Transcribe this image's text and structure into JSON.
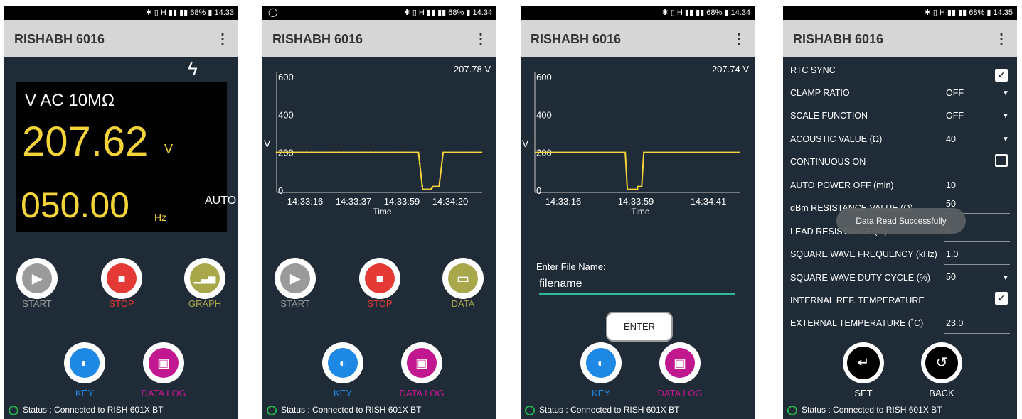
{
  "status_bar": {
    "icons": "✱ ▯ H ▮▮ ▮▮",
    "battery": "68%",
    "times": [
      "14:33",
      "14:34",
      "14:34",
      "14:35"
    ],
    "notif_icon": "whatsapp-icon"
  },
  "app": {
    "title": "RISHABH 6016",
    "menu_icon": "⋮"
  },
  "status_text": "Status : Connected to RISH 601X BT",
  "screen1": {
    "mode": "V AC 10MΩ",
    "value": "207.62",
    "unit": "V",
    "range": "AUTO",
    "freq": "050.00",
    "freq_unit": "Hz",
    "buttons": [
      {
        "label": "START",
        "color": "#9a9a9a"
      },
      {
        "label": "STOP",
        "color": "#e53935"
      },
      {
        "label": "GRAPH",
        "color": "#a8a84a"
      }
    ],
    "buttons2": [
      {
        "label": "KEY",
        "color": "#1e88e5"
      },
      {
        "label": "DATA LOG",
        "color": "#c2188f"
      }
    ]
  },
  "screen2": {
    "readout": "207.78 V",
    "buttons": [
      {
        "label": "START",
        "color": "#9a9a9a"
      },
      {
        "label": "STOP",
        "color": "#e53935"
      },
      {
        "label": "DATA",
        "color": "#a8a84a"
      }
    ],
    "buttons2": [
      {
        "label": "KEY",
        "color": "#1e88e5"
      },
      {
        "label": "DATA LOG",
        "color": "#c2188f"
      }
    ]
  },
  "screen3": {
    "readout": "207.74 V",
    "file_label": "Enter File Name:",
    "file_value": "filename",
    "enter_label": "ENTER",
    "buttons2": [
      {
        "label": "KEY",
        "color": "#1e88e5"
      },
      {
        "label": "DATA LOG",
        "color": "#c2188f"
      }
    ]
  },
  "screen4": {
    "rows": [
      {
        "label": "RTC SYNC",
        "value": "",
        "control": "checkbox-on"
      },
      {
        "label": "CLAMP RATIO",
        "value": "OFF",
        "control": "dropdown"
      },
      {
        "label": "SCALE FUNCTION",
        "value": "OFF",
        "control": "dropdown"
      },
      {
        "label": "ACOUSTIC VALUE (Ω)",
        "value": "40",
        "control": "dropdown"
      },
      {
        "label": "CONTINUOUS ON",
        "value": "",
        "control": "checkbox-off"
      },
      {
        "label": "AUTO POWER OFF (min)",
        "value": "10",
        "control": "input"
      },
      {
        "label": "dBm RESISTANCE VALUE (Ω)",
        "value": "50",
        "control": "input"
      },
      {
        "label": "LEAD RESISTANCE (Ω)",
        "value": "0",
        "control": "input"
      },
      {
        "label": "SQUARE WAVE FREQUENCY (kHz)",
        "value": "1.0",
        "control": "input"
      },
      {
        "label": "SQUARE WAVE DUTY CYCLE (%)",
        "value": "50",
        "control": "dropdown"
      },
      {
        "label": "INTERNAL REF. TEMPERATURE",
        "value": "",
        "control": "checkbox-on"
      },
      {
        "label": "EXTERNAL TEMPERATURE (˚C)",
        "value": "23.0",
        "control": "input"
      }
    ],
    "toast": "Data Read Successfully",
    "set_label": "SET",
    "back_label": "BACK"
  },
  "chart_data": [
    {
      "type": "line",
      "xlabel": "Time",
      "ylabel": "V",
      "ylim": [
        0,
        600
      ],
      "yticks": [
        "600",
        "400",
        "200",
        "0"
      ],
      "xticks": [
        "14:33:16",
        "14:33:37",
        "14:33:59",
        "14:34:20"
      ],
      "series": [
        {
          "color": "#f5d43a",
          "x": [
            0,
            0.69,
            0.71,
            0.75,
            0.76,
            0.79,
            0.81,
            0.83,
            1
          ],
          "y": [
            200,
            200,
            5,
            5,
            20,
            20,
            200,
            200,
            200
          ]
        }
      ],
      "markers": true
    },
    {
      "type": "line",
      "xlabel": "Time",
      "ylabel": "V",
      "ylim": [
        0,
        600
      ],
      "yticks": [
        "600",
        "400",
        "200",
        "0"
      ],
      "xticks": [
        "14:33:16",
        "14:33:59",
        "14:34:41"
      ],
      "series": [
        {
          "color": "#f5d43a",
          "x": [
            0,
            0.44,
            0.45,
            0.5,
            0.5,
            0.52,
            0.53,
            0.55,
            1
          ],
          "y": [
            200,
            200,
            5,
            5,
            20,
            20,
            200,
            200,
            200
          ]
        }
      ],
      "markers": false
    }
  ],
  "colors": {
    "bg": "#1f2b36",
    "accent": "#f5d43a",
    "status_ok": "#23b14d",
    "input_line": "#2eb8a0"
  }
}
